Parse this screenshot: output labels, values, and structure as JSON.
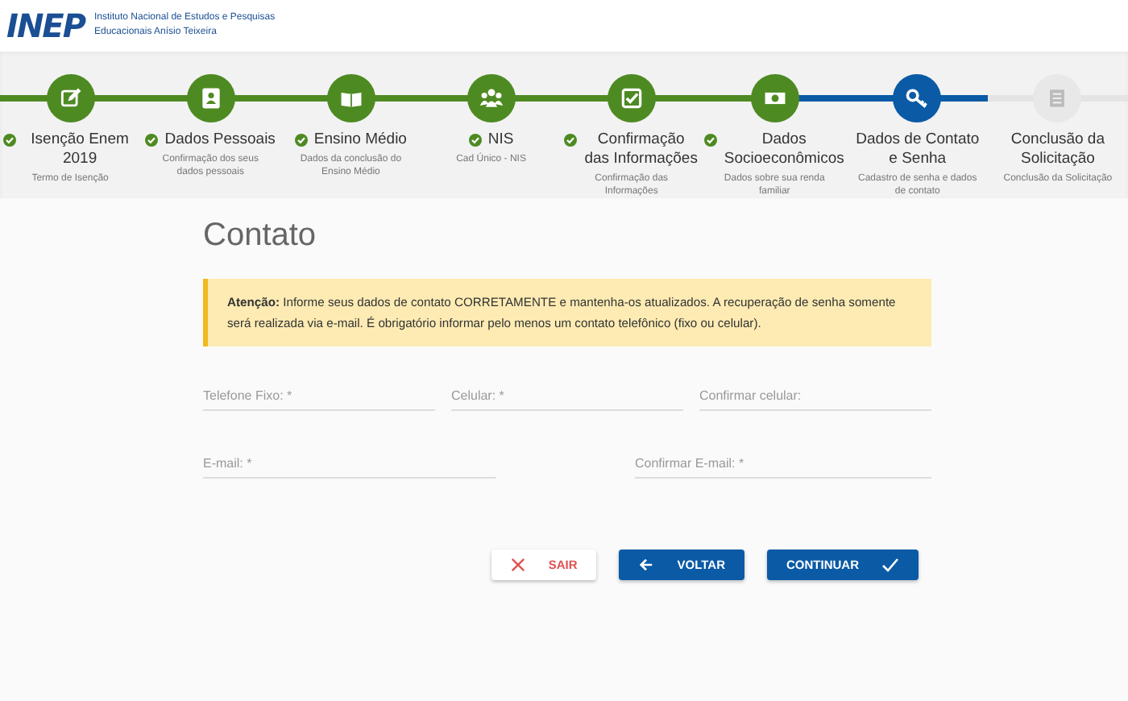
{
  "header": {
    "logo": "INEP",
    "org_line_1": "Instituto Nacional de Estudos e Pesquisas",
    "org_line_2": "Educacionais Anísio Teixeira"
  },
  "steps": [
    {
      "title": "Isenção Enem 2019",
      "subtitle": "Termo de Isenção",
      "completed": true,
      "selected": false
    },
    {
      "title": "Dados Pessoais",
      "subtitle": "Confirmação dos seus dados pessoais",
      "completed": true,
      "selected": false
    },
    {
      "title": "Ensino Médio",
      "subtitle": "Dados da conclusão do Ensino Médio",
      "completed": true,
      "selected": false
    },
    {
      "title": "NIS",
      "subtitle": "Cad Único - NIS",
      "completed": true,
      "selected": false
    },
    {
      "title": "Confirmação das Informações",
      "subtitle": "Confirmação das Informações",
      "completed": true,
      "selected": false
    },
    {
      "title": "Dados Socioeconômicos",
      "subtitle": "Dados sobre sua renda familiar",
      "completed": true,
      "selected": false
    },
    {
      "title": "Dados de Contato e Senha",
      "subtitle": "Cadastro de senha e dados de contato",
      "completed": false,
      "selected": true
    },
    {
      "title": "Conclusão da Solicitação",
      "subtitle": "Conclusão da Solicitação",
      "completed": false,
      "selected": false
    }
  ],
  "page_title": "Contato",
  "alert": "**Atenção:** Informe seus dados de contato CORRETAMENTE e mantenha-os atualizados. A recuperação de senha somente será realizada via e-mail. É obrigatório informar pelo menos um contato telefônico (fixo ou celular).",
  "fields_row_1": [
    {
      "placeholder": "Telefone Fixo: *"
    },
    {
      "placeholder": "Celular: *"
    },
    {
      "placeholder": "Confirmar celular:"
    }
  ],
  "fields_row_2": [
    {
      "placeholder": "E-mail: *"
    },
    {
      "placeholder": "Confirmar E-mail: *"
    }
  ],
  "buttons": [
    {
      "label": "SAIR",
      "kind": "exit"
    },
    {
      "label": "VOLTAR",
      "kind": "back"
    },
    {
      "label": "CONTINUAR",
      "kind": "next"
    }
  ]
}
